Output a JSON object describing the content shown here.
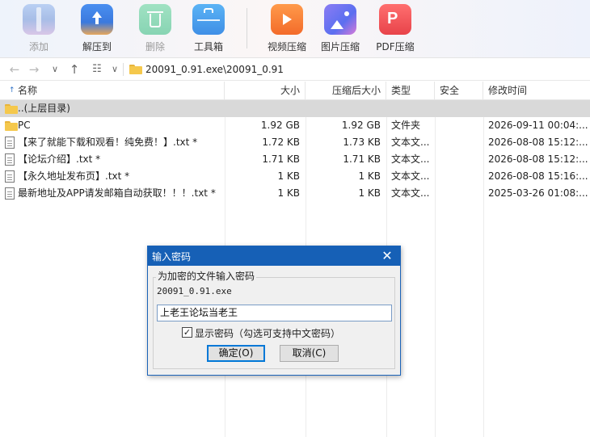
{
  "toolbar": {
    "items": [
      {
        "label": "添加",
        "icon": "add-archive-icon",
        "disabled": true
      },
      {
        "label": "解压到",
        "icon": "extract-icon",
        "disabled": false
      },
      {
        "label": "删除",
        "icon": "delete-icon",
        "disabled": true
      },
      {
        "label": "工具箱",
        "icon": "toolbox-icon",
        "disabled": false
      },
      {
        "label": "视频压缩",
        "icon": "video-compress-icon",
        "disabled": false
      },
      {
        "label": "图片压缩",
        "icon": "image-compress-icon",
        "disabled": false
      },
      {
        "label": "PDF压缩",
        "icon": "pdf-compress-icon",
        "disabled": false
      }
    ]
  },
  "address": {
    "path": "20091_0.91.exe\\20091_0.91"
  },
  "columns": [
    "名称",
    "大小",
    "压缩后大小",
    "类型",
    "安全",
    "修改时间"
  ],
  "files": [
    {
      "name": "..(上层目录)",
      "size": "",
      "packed": "",
      "type": "",
      "security": "",
      "modified": "",
      "kind": "folder",
      "selected": true
    },
    {
      "name": "PC",
      "size": "1.92 GB",
      "packed": "1.92 GB",
      "type": "文件夹",
      "security": "",
      "modified": "2026-09-11 00:04:...",
      "kind": "folder",
      "selected": false
    },
    {
      "name": "【来了就能下载和观看！纯免费！】.txt *",
      "size": "1.72 KB",
      "packed": "1.73 KB",
      "type": "文本文...",
      "security": "",
      "modified": "2026-08-08 15:12:...",
      "kind": "file",
      "selected": false
    },
    {
      "name": "【论坛介绍】.txt *",
      "size": "1.71 KB",
      "packed": "1.71 KB",
      "type": "文本文...",
      "security": "",
      "modified": "2026-08-08 15:12:...",
      "kind": "file",
      "selected": false
    },
    {
      "name": "【永久地址发布页】.txt *",
      "size": "1 KB",
      "packed": "1 KB",
      "type": "文本文...",
      "security": "",
      "modified": "2026-08-08 15:16:...",
      "kind": "file",
      "selected": false
    },
    {
      "name": "最新地址及APP请发邮箱自动获取！！！.txt *",
      "size": "1 KB",
      "packed": "1 KB",
      "type": "文本文...",
      "security": "",
      "modified": "2025-03-26 01:08:...",
      "kind": "file",
      "selected": false
    }
  ],
  "dialog": {
    "title": "输入密码",
    "group_label": "为加密的文件输入密码",
    "filename": "20091_0.91.exe",
    "password": "上老王论坛当老王",
    "show_password_label": "显示密码（勾选可支持中文密码）",
    "show_password_checked": true,
    "ok_label": "确定(O)",
    "cancel_label": "取消(C)"
  },
  "colors": {
    "accent": "#1660b6",
    "selection": "#d9d9d9",
    "folder": "#f5c84c"
  }
}
